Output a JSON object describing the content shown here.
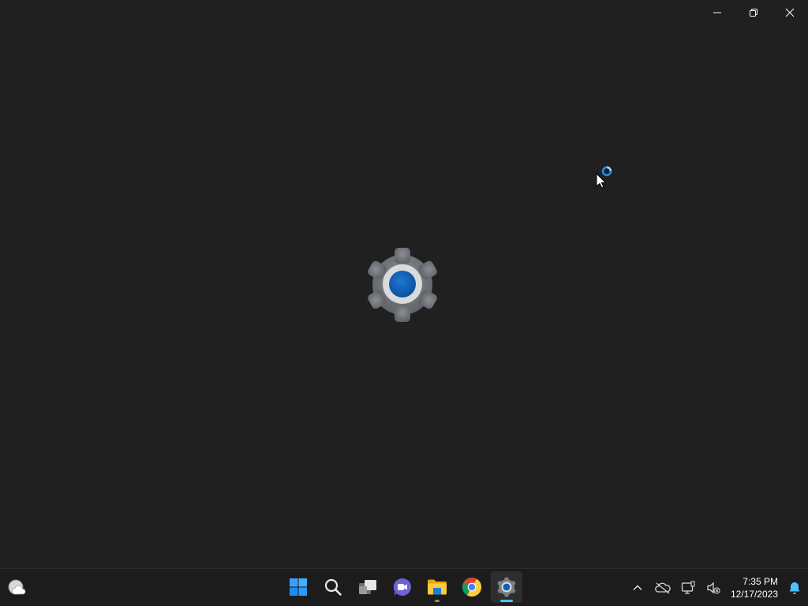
{
  "window": {
    "caption": {
      "minimize_icon": "minimize-icon",
      "maximize_icon": "restore-icon",
      "close_icon": "close-icon"
    },
    "splash_icon": "settings-gear-icon"
  },
  "taskbar": {
    "widgets_icon": "weather-cloud-icon",
    "apps": [
      {
        "name": "Start",
        "icon": "windows-start-icon",
        "state": "idle"
      },
      {
        "name": "Search",
        "icon": "search-icon",
        "state": "idle"
      },
      {
        "name": "Task View",
        "icon": "task-view-icon",
        "state": "idle"
      },
      {
        "name": "Chat",
        "icon": "teams-chat-icon",
        "state": "idle"
      },
      {
        "name": "File Explorer",
        "icon": "folder-icon",
        "state": "running"
      },
      {
        "name": "Google Chrome",
        "icon": "chrome-icon",
        "state": "idle"
      },
      {
        "name": "Settings",
        "icon": "settings-gear-icon",
        "state": "focused"
      }
    ],
    "tray": {
      "overflow_icon": "chevron-up-icon",
      "onedrive_icon": "onedrive-offline-icon",
      "network_icon": "network-icon",
      "volume_icon": "volume-muted-icon",
      "time": "7:35 PM",
      "date": "12/17/2023",
      "notification_icon": "bell-icon"
    }
  },
  "colors": {
    "background": "#202020",
    "taskbar": "#1c1c1c",
    "accent": "#4cc2ff",
    "gear_blue": "#0f5fb8"
  }
}
